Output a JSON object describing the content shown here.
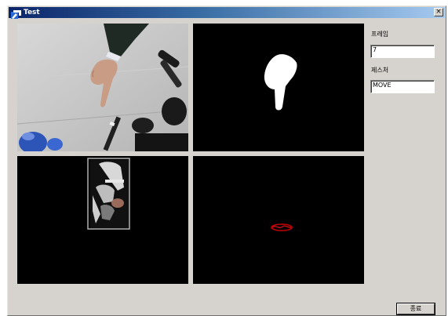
{
  "window": {
    "title": "Test",
    "close_glyph": "×"
  },
  "views": [
    {
      "name": "camera-frame",
      "content": "hand-pointing-photo"
    },
    {
      "name": "skin-mask",
      "content": "white-hand-silhouette"
    },
    {
      "name": "tracking-view",
      "content": "bounding-box-hand"
    },
    {
      "name": "motion-view",
      "content": "red-trajectory"
    }
  ],
  "panel": {
    "frame_label": "프레임",
    "frame_value": "7",
    "gesture_label": "제스처",
    "gesture_value": "MOVE"
  },
  "footer": {
    "confirm_label": "종료"
  },
  "colors": {
    "title_start": "#0a246a",
    "title_end": "#a6caf0",
    "window_bg": "#d6d3ce",
    "track_box": "#b0b0b0",
    "motion_red": "#c00000"
  }
}
